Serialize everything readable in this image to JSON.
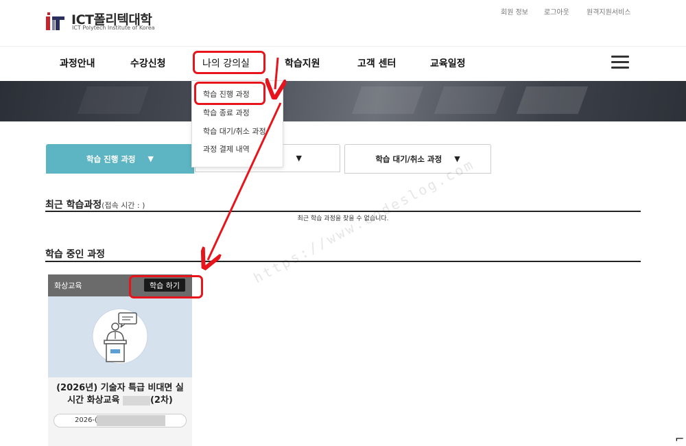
{
  "header": {
    "logo_text": "ICT폴리텍대학",
    "logo_sub": "ICT Polytech Institute of Korea",
    "util_links": [
      "회원 정보",
      "로그아웃",
      "원격지원서비스"
    ]
  },
  "nav": {
    "items": [
      "과정안내",
      "수강신청",
      "나의 강의실",
      "학습지원",
      "고객 센터",
      "교육일정"
    ],
    "menu_icon": "hamburger-menu-icon"
  },
  "dropdown": {
    "items": [
      "학습 진행 과정",
      "학습 종료 과정",
      "학습 대기/취소 과정",
      "과정 결제 내역"
    ]
  },
  "tabs": {
    "items": [
      {
        "label": "학습 진행 과정",
        "arrow": "▼"
      },
      {
        "label": "!",
        "arrow": "▼"
      },
      {
        "label": "학습 대기/취소 과정",
        "arrow": "▼"
      }
    ]
  },
  "recent": {
    "title": "최근 학습과정",
    "sub": "(접속 시간 : )",
    "empty": "최근 학습 과정을 찾을 수 없습니다."
  },
  "ongoing": {
    "title": "학습 중인 과정",
    "card": {
      "category": "화상교육",
      "button": "학습 하기",
      "title_line1": "(2026년) 기술자 특급 비대면 실",
      "title_line2a": "시간 화상교육",
      "title_line2b": "(2차)",
      "date": "2026-("
    }
  },
  "watermark": "https://www.codeslog.com",
  "colors": {
    "accent": "#5db4c3",
    "highlight": "#e8141b",
    "card_header": "#6b6b6b"
  }
}
